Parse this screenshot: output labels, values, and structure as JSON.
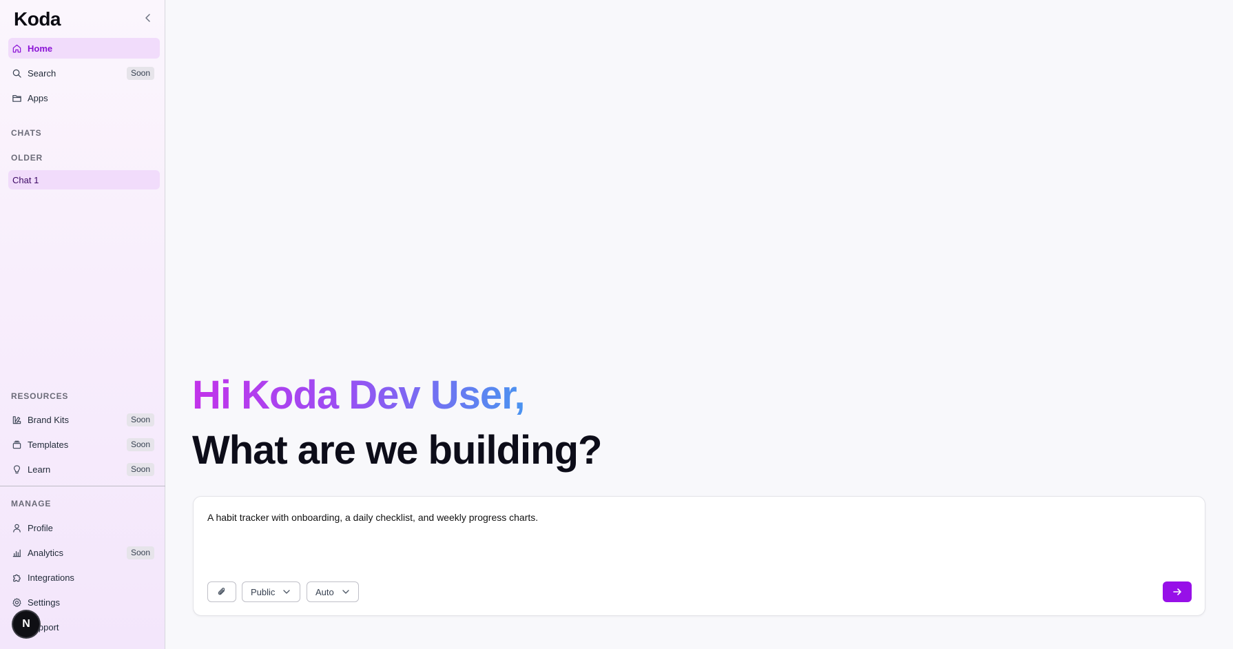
{
  "app": {
    "logo": "Koda"
  },
  "sidebar": {
    "nav": [
      {
        "label": "Home",
        "icon": "home-icon",
        "active": true
      },
      {
        "label": "Search",
        "icon": "search-icon",
        "badge": "Soon"
      },
      {
        "label": "Apps",
        "icon": "folder-icon"
      }
    ],
    "chats_label": "CHATS",
    "older_label": "OLDER",
    "chats": [
      {
        "label": "Chat 1"
      }
    ],
    "resources_label": "RESOURCES",
    "resources": [
      {
        "label": "Brand Kits",
        "icon": "brand-kit-icon",
        "badge": "Soon"
      },
      {
        "label": "Templates",
        "icon": "templates-icon",
        "badge": "Soon"
      },
      {
        "label": "Learn",
        "icon": "lightbulb-icon",
        "badge": "Soon"
      }
    ],
    "manage_label": "MANAGE",
    "manage": [
      {
        "label": "Profile",
        "icon": "user-icon"
      },
      {
        "label": "Analytics",
        "icon": "bar-chart-icon",
        "badge": "Soon"
      },
      {
        "label": "Integrations",
        "icon": "puzzle-icon"
      },
      {
        "label": "Settings",
        "icon": "gear-icon"
      },
      {
        "label": "Support",
        "icon": "help-icon"
      }
    ],
    "avatar_initial": "N"
  },
  "main": {
    "greeting": "Hi Koda Dev User,",
    "headline": "What are we building?",
    "composer": {
      "value": "A habit tracker with onboarding, a daily checklist, and weekly progress charts.",
      "visibility": "Public",
      "model": "Auto"
    }
  },
  "colors": {
    "accent": "#9710e8",
    "active_bg": "#f1dcfb",
    "active_text": "#8b12d6"
  }
}
